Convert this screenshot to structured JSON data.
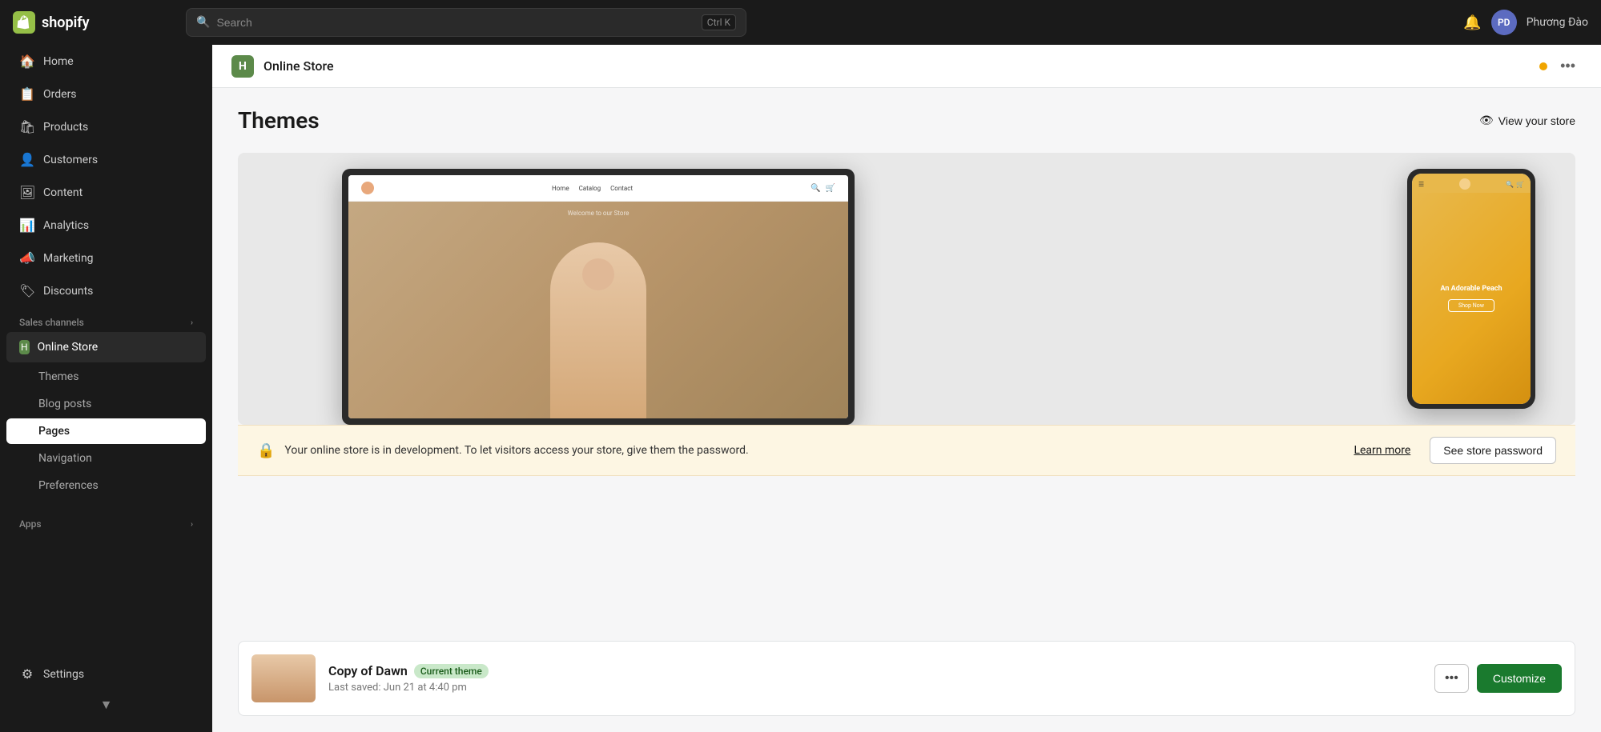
{
  "topbar": {
    "logo_text": "shopify",
    "search_placeholder": "Search",
    "search_shortcut": "Ctrl K",
    "user_initials": "PD",
    "user_name": "Phương Đào"
  },
  "sidebar": {
    "nav_items": [
      {
        "id": "home",
        "label": "Home",
        "icon": "🏠"
      },
      {
        "id": "orders",
        "label": "Orders",
        "icon": "📋"
      },
      {
        "id": "products",
        "label": "Products",
        "icon": "🛍"
      },
      {
        "id": "customers",
        "label": "Customers",
        "icon": "👤"
      },
      {
        "id": "content",
        "label": "Content",
        "icon": "🖼"
      },
      {
        "id": "analytics",
        "label": "Analytics",
        "icon": "📊"
      },
      {
        "id": "marketing",
        "label": "Marketing",
        "icon": "📣"
      },
      {
        "id": "discounts",
        "label": "Discounts",
        "icon": "🏷"
      }
    ],
    "sales_channels_label": "Sales channels",
    "online_store_label": "Online Store",
    "sub_items": [
      {
        "id": "themes",
        "label": "Themes",
        "active": false
      },
      {
        "id": "blog-posts",
        "label": "Blog posts",
        "active": false
      },
      {
        "id": "pages",
        "label": "Pages",
        "active": true
      },
      {
        "id": "navigation",
        "label": "Navigation",
        "active": false
      },
      {
        "id": "preferences",
        "label": "Preferences",
        "active": false
      }
    ],
    "apps_label": "Apps",
    "settings_label": "Settings"
  },
  "content_header": {
    "icon_letter": "H",
    "title": "Online Store"
  },
  "themes_page": {
    "title": "Themes",
    "view_store_label": "View your store",
    "preview": {
      "desktop_welcome": "Welcome to our Store",
      "desktop_nav_links": [
        "Home",
        "Catalog",
        "Contact"
      ],
      "mobile_hero_text": "An Adorable Peach",
      "mobile_btn_label": "Shop Now"
    },
    "dev_banner": {
      "text": "Your online store is in development. To let visitors access your store, give them the password.",
      "learn_more": "Learn more",
      "see_password": "See store password"
    },
    "current_theme": {
      "name": "Copy of Dawn",
      "badge": "Current theme",
      "saved": "Last saved: Jun 21 at 4:40 pm",
      "more_icon": "•••",
      "customize_label": "Customize"
    }
  }
}
